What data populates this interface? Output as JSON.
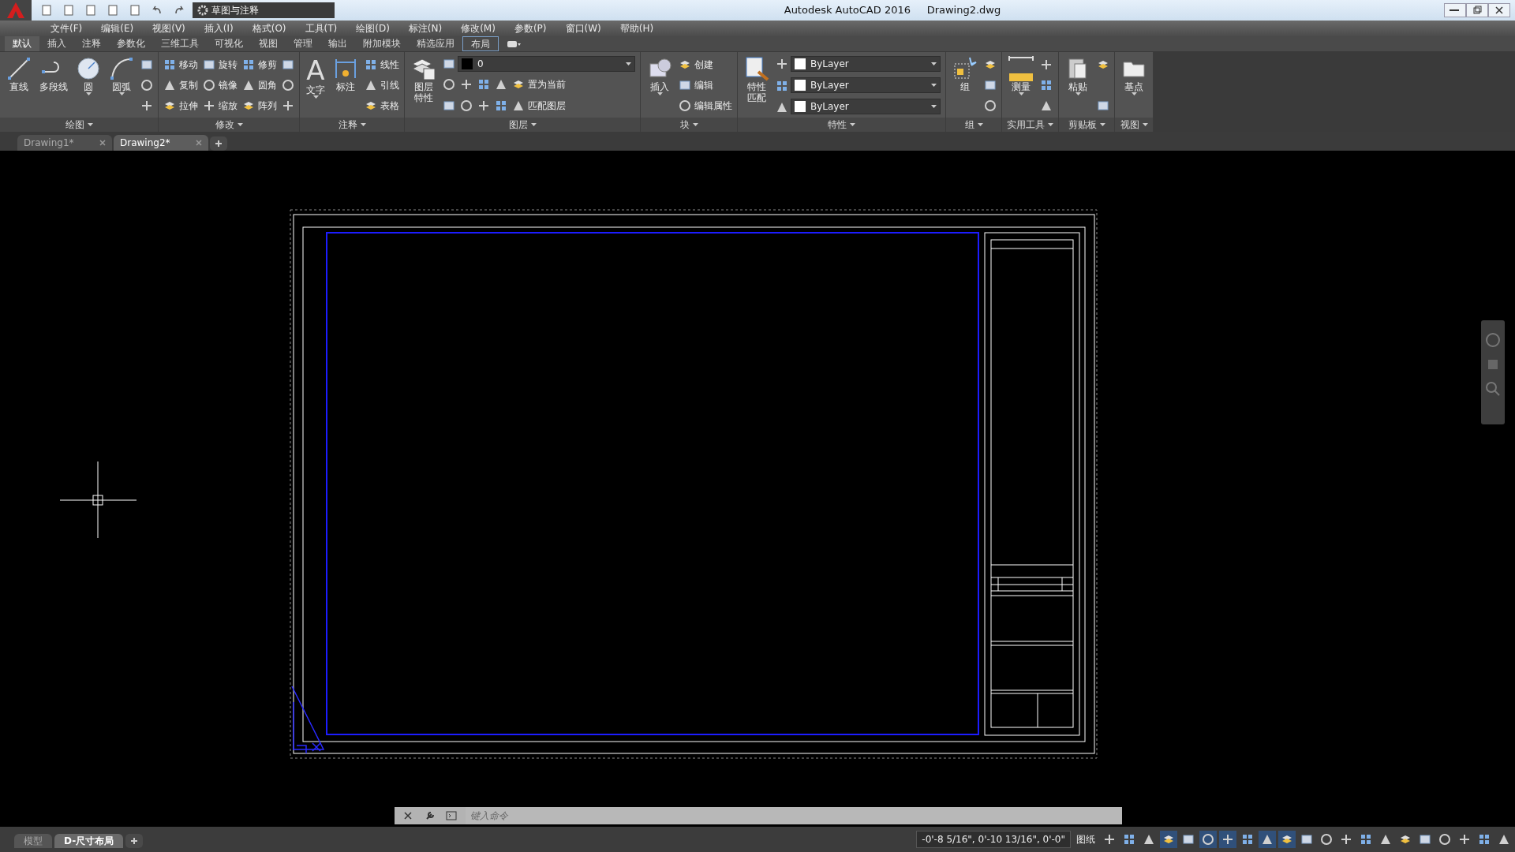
{
  "app": {
    "title": "Autodesk AutoCAD 2016",
    "file": "Drawing2.dwg",
    "workspace": "草图与注释"
  },
  "menu": [
    "文件(F)",
    "编辑(E)",
    "视图(V)",
    "插入(I)",
    "格式(O)",
    "工具(T)",
    "绘图(D)",
    "标注(N)",
    "修改(M)",
    "参数(P)",
    "窗口(W)",
    "帮助(H)"
  ],
  "ribbon_tabs": [
    {
      "label": "默认",
      "selected": true
    },
    {
      "label": "插入",
      "selected": false
    },
    {
      "label": "注释",
      "selected": false
    },
    {
      "label": "参数化",
      "selected": false
    },
    {
      "label": "三维工具",
      "selected": false
    },
    {
      "label": "可视化",
      "selected": false
    },
    {
      "label": "视图",
      "selected": false
    },
    {
      "label": "管理",
      "selected": false
    },
    {
      "label": "输出",
      "selected": false
    },
    {
      "label": "附加模块",
      "selected": false
    },
    {
      "label": "精选应用",
      "selected": false
    },
    {
      "label": "布局",
      "selected": false,
      "contextual": true
    }
  ],
  "ribbon_panels": [
    {
      "title": "绘图",
      "columns": [
        {
          "kind": "large",
          "label": "直线"
        },
        {
          "kind": "large",
          "label": "多段线"
        },
        {
          "kind": "large",
          "label": "圆",
          "caret": true
        },
        {
          "kind": "large",
          "label": "圆弧",
          "caret": true
        },
        {
          "kind": "stack",
          "items": [
            {
              "kind": "icon"
            },
            {
              "kind": "icon"
            },
            {
              "kind": "icon"
            }
          ]
        }
      ]
    },
    {
      "title": "修改",
      "columns": [
        {
          "kind": "stack",
          "items": [
            {
              "kind": "tool",
              "label": "移动"
            },
            {
              "kind": "tool",
              "label": "复制"
            },
            {
              "kind": "tool",
              "label": "拉伸"
            }
          ]
        },
        {
          "kind": "stack",
          "items": [
            {
              "kind": "tool",
              "label": "旋转"
            },
            {
              "kind": "tool",
              "label": "镜像"
            },
            {
              "kind": "tool",
              "label": "缩放"
            }
          ]
        },
        {
          "kind": "stack",
          "items": [
            {
              "kind": "tool",
              "label": "修剪"
            },
            {
              "kind": "tool",
              "label": "圆角"
            },
            {
              "kind": "tool",
              "label": "阵列"
            }
          ]
        },
        {
          "kind": "stack",
          "items": [
            {
              "kind": "icon"
            },
            {
              "kind": "icon"
            },
            {
              "kind": "icon"
            }
          ]
        }
      ]
    },
    {
      "title": "注释",
      "columns": [
        {
          "kind": "large",
          "label": "文字",
          "glyph": "A",
          "caret": true
        },
        {
          "kind": "large",
          "label": "标注"
        },
        {
          "kind": "stack",
          "items": [
            {
              "kind": "tool",
              "label": "线性"
            },
            {
              "kind": "tool",
              "label": "引线"
            },
            {
              "kind": "tool",
              "label": "表格"
            }
          ]
        }
      ]
    },
    {
      "title": "图层",
      "columns": [
        {
          "kind": "large",
          "label": "图层特性",
          "wrap": true
        },
        {
          "kind": "stack",
          "items": [
            {
              "kind": "dropdown",
              "value": "0"
            },
            {
              "kind": "iconrow",
              "label": "置为当前"
            },
            {
              "kind": "iconrow",
              "label": "匹配图层"
            }
          ]
        }
      ]
    },
    {
      "title": "块",
      "columns": [
        {
          "kind": "large",
          "label": "插入",
          "caret": true
        },
        {
          "kind": "stack",
          "items": [
            {
              "kind": "tool",
              "label": "创建"
            },
            {
              "kind": "tool",
              "label": "编辑"
            },
            {
              "kind": "tool",
              "label": "编辑属性"
            }
          ]
        }
      ]
    },
    {
      "title": "特性",
      "columns": [
        {
          "kind": "large",
          "label": "特性匹配",
          "wrap": true
        },
        {
          "kind": "stack",
          "items": [
            {
              "kind": "dropdown",
              "value": "ByLayer"
            },
            {
              "kind": "dropdown",
              "value": "ByLayer"
            },
            {
              "kind": "dropdown",
              "value": "ByLayer"
            }
          ]
        }
      ]
    },
    {
      "title": "组",
      "columns": [
        {
          "kind": "large",
          "label": "组"
        },
        {
          "kind": "stack",
          "items": [
            {
              "kind": "icon"
            },
            {
              "kind": "icon"
            },
            {
              "kind": "icon"
            }
          ]
        }
      ]
    },
    {
      "title": "实用工具",
      "columns": [
        {
          "kind": "large",
          "label": "测量",
          "caret": true
        },
        {
          "kind": "stack",
          "items": [
            {
              "kind": "icon"
            },
            {
              "kind": "icon"
            },
            {
              "kind": "icon"
            }
          ]
        }
      ]
    },
    {
      "title": "剪贴板",
      "columns": [
        {
          "kind": "large",
          "label": "粘贴",
          "caret": true
        },
        {
          "kind": "stack",
          "items": [
            {
              "kind": "icon"
            },
            {
              "kind": "icon"
            }
          ]
        }
      ]
    },
    {
      "title": "视图",
      "columns": [
        {
          "kind": "large",
          "label": "基点",
          "caret": true
        }
      ]
    }
  ],
  "doc_tabs": [
    {
      "label": "Drawing1*",
      "selected": false
    },
    {
      "label": "Drawing2*",
      "selected": true
    }
  ],
  "command": {
    "placeholder": "键入命令"
  },
  "layout_tabs": [
    {
      "label": "模型",
      "selected": false
    },
    {
      "label": "D-尺寸布局",
      "selected": true
    }
  ],
  "status": {
    "coords": "-0'-8 5/16\", 0'-10 13/16\", 0'-0\"",
    "space": "图纸",
    "toggles": [
      {
        "on": false
      },
      {
        "on": false
      },
      {
        "on": false
      },
      {
        "on": true
      },
      {
        "on": false
      },
      {
        "on": true
      },
      {
        "on": true
      },
      {
        "on": false
      },
      {
        "on": true
      },
      {
        "on": true
      },
      {
        "on": false
      },
      {
        "on": false
      },
      {
        "on": false
      },
      {
        "on": false
      },
      {
        "on": false
      },
      {
        "on": false
      },
      {
        "on": false
      },
      {
        "on": false
      },
      {
        "on": false
      },
      {
        "on": false
      },
      {
        "on": false
      }
    ]
  }
}
